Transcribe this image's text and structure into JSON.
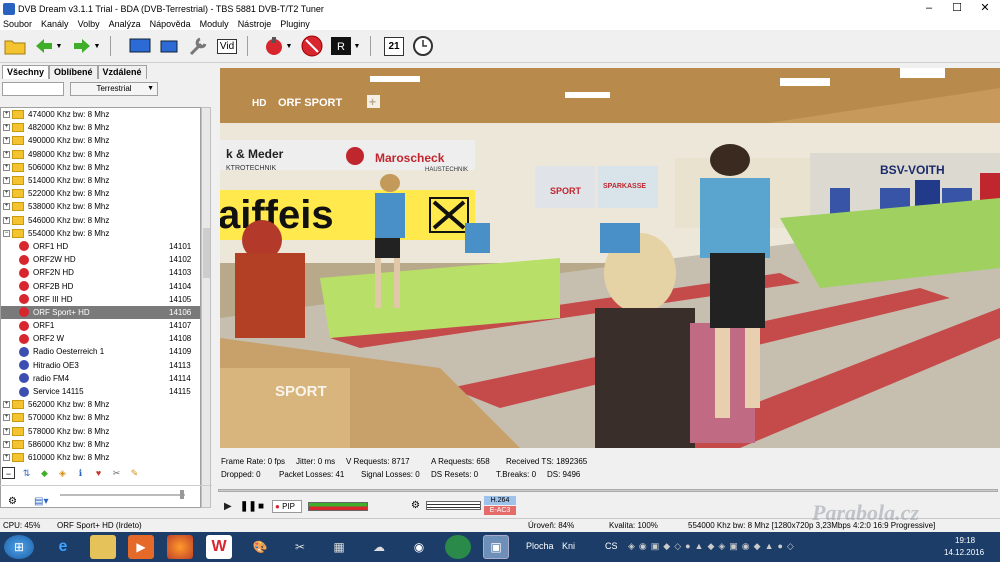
{
  "window": {
    "title": "DVB Dream v3.1.1 Trial - BDA (DVB-Terrestrial) - TBS 5881 DVB-T/T2 Tuner",
    "minimize": "–",
    "maximize": "☐",
    "close": "✕"
  },
  "menu": [
    "Soubor",
    "Kanály",
    "Volby",
    "Analýza",
    "Nápověda",
    "Moduly",
    "Nástroje",
    "Pluginy"
  ],
  "toolbar": {
    "vid_label": "Vid",
    "calendar_label": "21"
  },
  "left": {
    "tabs": [
      "Všechny",
      "Oblíbené",
      "Vzdálené"
    ],
    "combo_value": "Terrestrial",
    "tree": [
      {
        "type": "folder",
        "sign": "+",
        "label": "474000 Khz  bw: 8 Mhz"
      },
      {
        "type": "folder",
        "sign": "+",
        "label": "482000 Khz  bw: 8 Mhz"
      },
      {
        "type": "folder",
        "sign": "+",
        "label": "490000 Khz  bw: 8 Mhz"
      },
      {
        "type": "folder",
        "sign": "+",
        "label": "498000 Khz  bw: 8 Mhz"
      },
      {
        "type": "folder",
        "sign": "+",
        "label": "506000 Khz  bw: 8 Mhz"
      },
      {
        "type": "folder",
        "sign": "+",
        "label": "514000 Khz  bw: 8 Mhz"
      },
      {
        "type": "folder",
        "sign": "+",
        "label": "522000 Khz  bw: 8 Mhz"
      },
      {
        "type": "folder",
        "sign": "+",
        "label": "538000 Khz  bw: 8 Mhz"
      },
      {
        "type": "folder",
        "sign": "+",
        "label": "546000 Khz  bw: 8 Mhz"
      },
      {
        "type": "folder",
        "sign": "−",
        "label": "554000 Khz  bw: 8 Mhz"
      },
      {
        "type": "tv",
        "label": "ORF1 HD",
        "num": "14101"
      },
      {
        "type": "tv",
        "label": "ORF2W HD",
        "num": "14102"
      },
      {
        "type": "tv",
        "label": "ORF2N HD",
        "num": "14103"
      },
      {
        "type": "tv",
        "label": "ORF2B HD",
        "num": "14104"
      },
      {
        "type": "tv",
        "label": "ORF III HD",
        "num": "14105"
      },
      {
        "type": "tv",
        "label": "ORF Sport+ HD",
        "num": "14106",
        "selected": true
      },
      {
        "type": "tv",
        "label": "ORF1",
        "num": "14107"
      },
      {
        "type": "tv",
        "label": "ORF2 W",
        "num": "14108"
      },
      {
        "type": "radio",
        "label": "Radio Oesterreich 1",
        "num": "14109"
      },
      {
        "type": "radio",
        "label": "Hitradio OE3",
        "num": "14113"
      },
      {
        "type": "radio",
        "label": "radio FM4",
        "num": "14114"
      },
      {
        "type": "radio",
        "label": "Service 14115",
        "num": "14115"
      },
      {
        "type": "folder",
        "sign": "+",
        "label": "562000 Khz  bw: 8 Mhz"
      },
      {
        "type": "folder",
        "sign": "+",
        "label": "570000 Khz  bw: 8 Mhz"
      },
      {
        "type": "folder",
        "sign": "+",
        "label": "578000 Khz  bw: 8 Mhz"
      },
      {
        "type": "folder",
        "sign": "+",
        "label": "586000 Khz  bw: 8 Mhz"
      },
      {
        "type": "folder",
        "sign": "+",
        "label": "610000 Khz  bw: 8 Mhz"
      }
    ]
  },
  "video": {
    "logo_hd": "HD",
    "logo_channel": "ORF SPORT",
    "logo_plus": "+",
    "watermark": "SPORT",
    "banner_meder": "k & Meder",
    "banner_elektro": "KTROTECHNIK",
    "banner_marscheck": "Maroscheck",
    "banner_haustechnik": "HAUSTECHNIK",
    "banner_raiffeisen": "aiffeis",
    "banner_sport": "SPORT",
    "banner_sparkasse": "SPARKASSE",
    "banner_bsv": "BSV-VOITH"
  },
  "info": {
    "frame_rate": "Frame Rate: 0 fps",
    "jitter": "Jitter: 0 ms",
    "v_requests": "V Requests: 8717",
    "a_requests": "A Requests: 658",
    "received_ts": "Received TS: 1892365",
    "dropped": "Dropped: 0",
    "packet_losses": "Packet Losses: 41",
    "signal_losses": "Signal Losses: 0",
    "ds_resets": "DS Resets: 0",
    "t_breaks": "T.Breaks: 0",
    "ds": "DS: 9496"
  },
  "player": {
    "pip_label": "PIP",
    "video_codec": "H.264",
    "audio_codec": "E-AC3"
  },
  "status": {
    "cpu": "CPU: 45%",
    "channel": "ORF Sport+ HD (Irdeto)",
    "level": "Úroveň: 84%",
    "quality": "Kvalita: 100%",
    "stream": "554000 Khz  bw: 8 Mhz [1280x720p  3,23Mbps 4:2:0  16:9 Progressive]"
  },
  "taskbar": {
    "desktop_label": "Plocha",
    "kni_label": "Kni",
    "lang": "CS",
    "time": "19:18",
    "date": "14.12.2016"
  },
  "watermark_site": "Parabola.cz",
  "colors": {
    "titlebar": "#ffffff",
    "taskbar": "#1b3d68",
    "selection": "#7a7a7a",
    "tv_icon": "#d8262e",
    "radio_icon": "#3c4fb0"
  }
}
